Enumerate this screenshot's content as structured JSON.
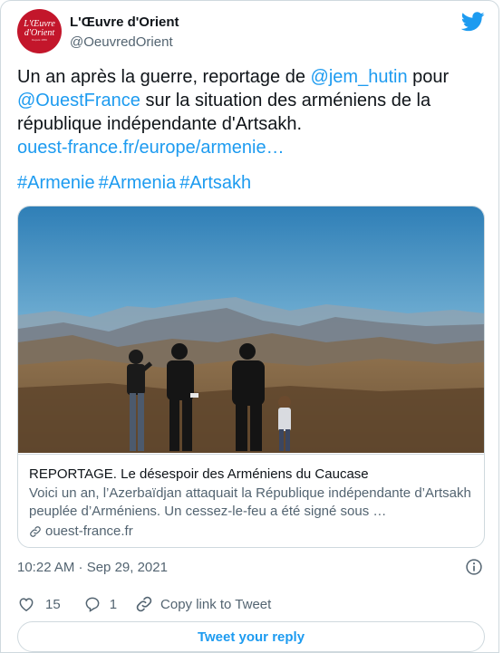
{
  "author": {
    "name": "L'Œuvre d'Orient",
    "handle": "@OeuvredOrient",
    "avatar_line1": "L'Œuvre",
    "avatar_line2": "d'Orient",
    "avatar_line3": "Depuis 1856"
  },
  "tweet": {
    "text_part1": "Un an après la guerre, reportage de ",
    "mention1": "@jem_hutin",
    "text_part2": " pour ",
    "mention2": "@OuestFrance",
    "text_part3": " sur la situation des arméniens de la république indépendante d'Artsakh.",
    "link": "ouest-france.fr/europe/armenie…",
    "hashtags": [
      "#Armenie",
      "#Armenia",
      "#Artsakh"
    ]
  },
  "card": {
    "image_alt": "Four people looking over mountains",
    "title": "REPORTAGE. Le désespoir des Arméniens du Caucase",
    "description": "Voici un an, l’Azerbaïdjan attaquait la République indépendante d’Artsakh peuplée d’Arméniens. Un cessez-le-feu a été signé sous …",
    "domain": "ouest-france.fr"
  },
  "meta": {
    "timestamp": "10:22 AM · Sep 29, 2021"
  },
  "actions": {
    "likes": "15",
    "replies": "1",
    "copy_link": "Copy link to Tweet",
    "reply_button": "Tweet your reply"
  },
  "colors": {
    "accent": "#1d9bf0",
    "avatar_bg": "#c3162b",
    "text_secondary": "#536471"
  }
}
